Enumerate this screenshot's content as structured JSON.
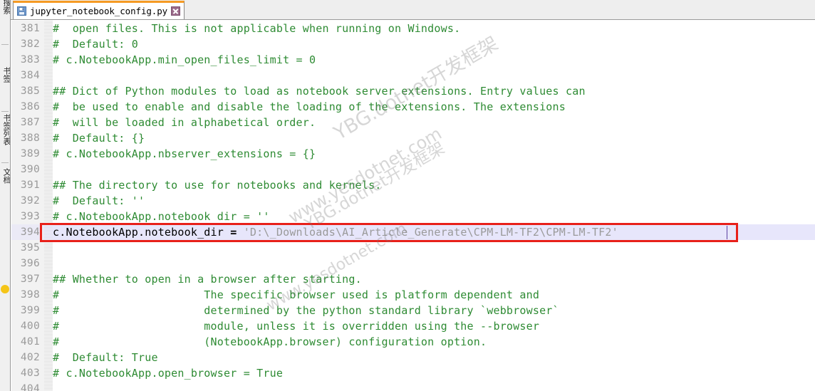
{
  "window": {
    "app_kind": "code-editor",
    "accent_color": "#f59a23",
    "comment_color": "#2e8b33",
    "string_color": "#9a9a9a",
    "highlight_color": "#e7e6fb",
    "annotation_color": "#e8201a"
  },
  "left_strip": {
    "tabs": [
      {
        "label": "搜索"
      },
      {
        "label": "书签"
      },
      {
        "label": "书签列表"
      },
      {
        "label": "文档"
      }
    ]
  },
  "tabbar": {
    "tabs": [
      {
        "title": "jupyter_notebook_config.py",
        "icon": "save-disk-icon",
        "close_icon": "close-icon",
        "active": true
      }
    ]
  },
  "editor": {
    "first_line": 381,
    "lines": [
      {
        "n": 381,
        "tokens": [
          {
            "t": "comment",
            "s": "#  open files. This is not applicable when running on Windows."
          }
        ]
      },
      {
        "n": 382,
        "tokens": [
          {
            "t": "comment",
            "s": "#  Default: 0"
          }
        ]
      },
      {
        "n": 383,
        "tokens": [
          {
            "t": "comment",
            "s": "# c.NotebookApp.min_open_files_limit = 0"
          }
        ]
      },
      {
        "n": 384,
        "tokens": [
          {
            "t": "plain",
            "s": ""
          }
        ]
      },
      {
        "n": 385,
        "tokens": [
          {
            "t": "comment",
            "s": "## Dict of Python modules to load as notebook server extensions. Entry values can"
          }
        ]
      },
      {
        "n": 386,
        "tokens": [
          {
            "t": "comment",
            "s": "#  be used to enable and disable the loading of the extensions. The extensions"
          }
        ]
      },
      {
        "n": 387,
        "tokens": [
          {
            "t": "comment",
            "s": "#  will be loaded in alphabetical order."
          }
        ]
      },
      {
        "n": 388,
        "tokens": [
          {
            "t": "comment",
            "s": "#  Default: {}"
          }
        ]
      },
      {
        "n": 389,
        "tokens": [
          {
            "t": "comment",
            "s": "# c.NotebookApp.nbserver_extensions = {}"
          }
        ]
      },
      {
        "n": 390,
        "tokens": [
          {
            "t": "plain",
            "s": ""
          }
        ]
      },
      {
        "n": 391,
        "tokens": [
          {
            "t": "comment",
            "s": "## The directory to use for notebooks and kernels."
          }
        ]
      },
      {
        "n": 392,
        "tokens": [
          {
            "t": "comment",
            "s": "#  Default: ''"
          }
        ]
      },
      {
        "n": 393,
        "tokens": [
          {
            "t": "comment",
            "s": "# c.NotebookApp.notebook dir = ''"
          }
        ]
      },
      {
        "n": 394,
        "highlight": true,
        "boxed": true,
        "tokens": [
          {
            "t": "plain",
            "s": "c.NotebookApp.notebook_dir "
          },
          {
            "t": "op",
            "s": "="
          },
          {
            "t": "plain",
            "s": " "
          },
          {
            "t": "string",
            "s": "'D:\\_Downloads\\AI_Article_Generate\\CPM-LM-TF2\\CPM-LM-TF2'"
          }
        ]
      },
      {
        "n": 395,
        "tokens": [
          {
            "t": "plain",
            "s": ""
          }
        ]
      },
      {
        "n": 396,
        "tokens": [
          {
            "t": "plain",
            "s": ""
          }
        ]
      },
      {
        "n": 397,
        "tokens": [
          {
            "t": "comment",
            "s": "## Whether to open in a browser after starting."
          }
        ]
      },
      {
        "n": 398,
        "tokens": [
          {
            "t": "comment",
            "s": "#                      The specific browser used is platform dependent and"
          }
        ]
      },
      {
        "n": 399,
        "tokens": [
          {
            "t": "comment",
            "s": "#                      determined by the python standard library `webbrowser`"
          }
        ]
      },
      {
        "n": 400,
        "tokens": [
          {
            "t": "comment",
            "s": "#                      module, unless it is overridden using the --browser"
          }
        ]
      },
      {
        "n": 401,
        "tokens": [
          {
            "t": "comment",
            "s": "#                      (NotebookApp.browser) configuration option."
          }
        ]
      },
      {
        "n": 402,
        "tokens": [
          {
            "t": "comment",
            "s": "#  Default: True"
          }
        ]
      },
      {
        "n": 403,
        "tokens": [
          {
            "t": "comment",
            "s": "# c.NotebookApp.open_browser = True"
          }
        ]
      },
      {
        "n": 404,
        "tokens": [
          {
            "t": "plain",
            "s": ""
          }
        ]
      }
    ]
  },
  "watermarks": [
    {
      "text": "YBG.dotnet开发框架"
    },
    {
      "text": "www.yesdotnet.com"
    },
    {
      "text": "YBG.dotnet开发框架"
    },
    {
      "text": "www.yesdotnet.com"
    }
  ]
}
